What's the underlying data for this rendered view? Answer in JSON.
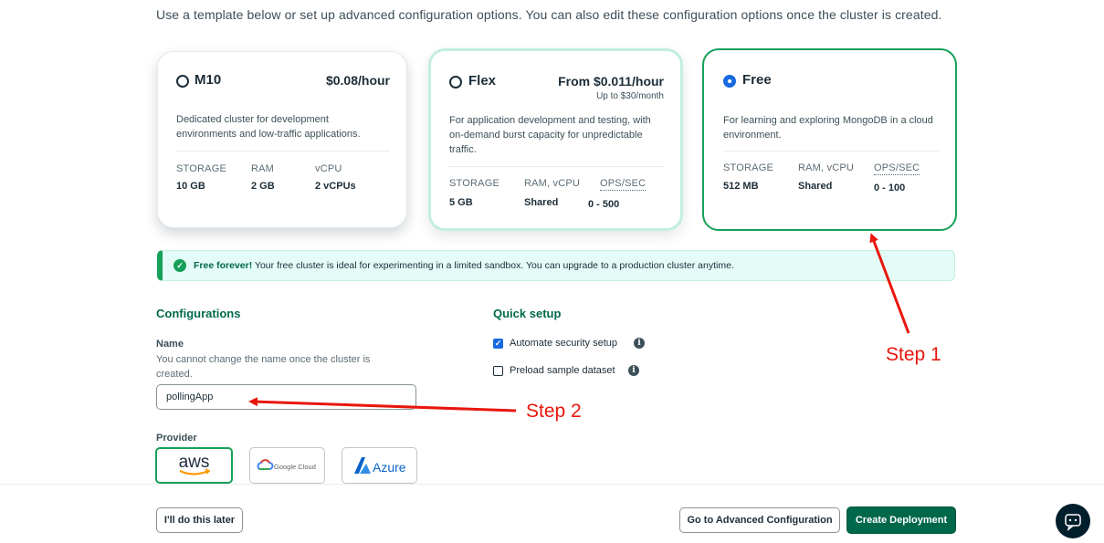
{
  "intro_text": "Use a template below or set up advanced configuration options. You can also edit these configuration options once the cluster is created.",
  "plans": [
    {
      "name": "M10",
      "price": "$0.08/hour",
      "price_sub": "",
      "selected": false,
      "description": "Dedicated cluster for development environments and low-traffic applications.",
      "specs": [
        {
          "label": "STORAGE",
          "value": "10 GB"
        },
        {
          "label": "RAM",
          "value": "2 GB"
        },
        {
          "label": "vCPU",
          "value": "2 vCPUs"
        }
      ]
    },
    {
      "name": "Flex",
      "price": "From $0.011/hour",
      "price_sub": "Up to $30/month",
      "selected": false,
      "description": "For application development and testing, with on-demand burst capacity for unpredictable traffic.",
      "specs": [
        {
          "label": "STORAGE",
          "value": "5 GB"
        },
        {
          "label": "RAM, vCPU",
          "value": "Shared"
        },
        {
          "label": "OPS/SEC",
          "value": "0 - 500"
        }
      ]
    },
    {
      "name": "Free",
      "price": "",
      "price_sub": "",
      "selected": true,
      "description": "For learning and exploring MongoDB in a cloud environment.",
      "specs": [
        {
          "label": "STORAGE",
          "value": "512 MB"
        },
        {
          "label": "RAM, vCPU",
          "value": "Shared"
        },
        {
          "label": "OPS/SEC",
          "value": "0 - 100"
        }
      ]
    }
  ],
  "banner": {
    "bold": "Free forever!",
    "text": " Your free cluster is ideal for experimenting in a limited sandbox. You can upgrade to a production cluster anytime."
  },
  "configurations": {
    "title": "Configurations",
    "name_label": "Name",
    "name_help": "You cannot change the name once the cluster is created.",
    "name_value": "pollingApp",
    "provider_label": "Provider",
    "providers": [
      "aws",
      "Google Cloud",
      "Azure"
    ],
    "selected_provider": "aws"
  },
  "quick_setup": {
    "title": "Quick setup",
    "options": [
      {
        "label": "Automate security setup",
        "checked": true
      },
      {
        "label": "Preload sample dataset",
        "checked": false
      }
    ]
  },
  "footer": {
    "later": "I'll do this later",
    "advanced": "Go to Advanced Configuration",
    "create": "Create Deployment"
  },
  "annotations": {
    "step1": "Step 1",
    "step2": "Step 2",
    "color": "#e8160c"
  },
  "colors": {
    "brand_green": "#00684a",
    "accent_green": "#16a05a",
    "select_blue": "#1769e0",
    "banner_bg": "#e3fcf7"
  }
}
